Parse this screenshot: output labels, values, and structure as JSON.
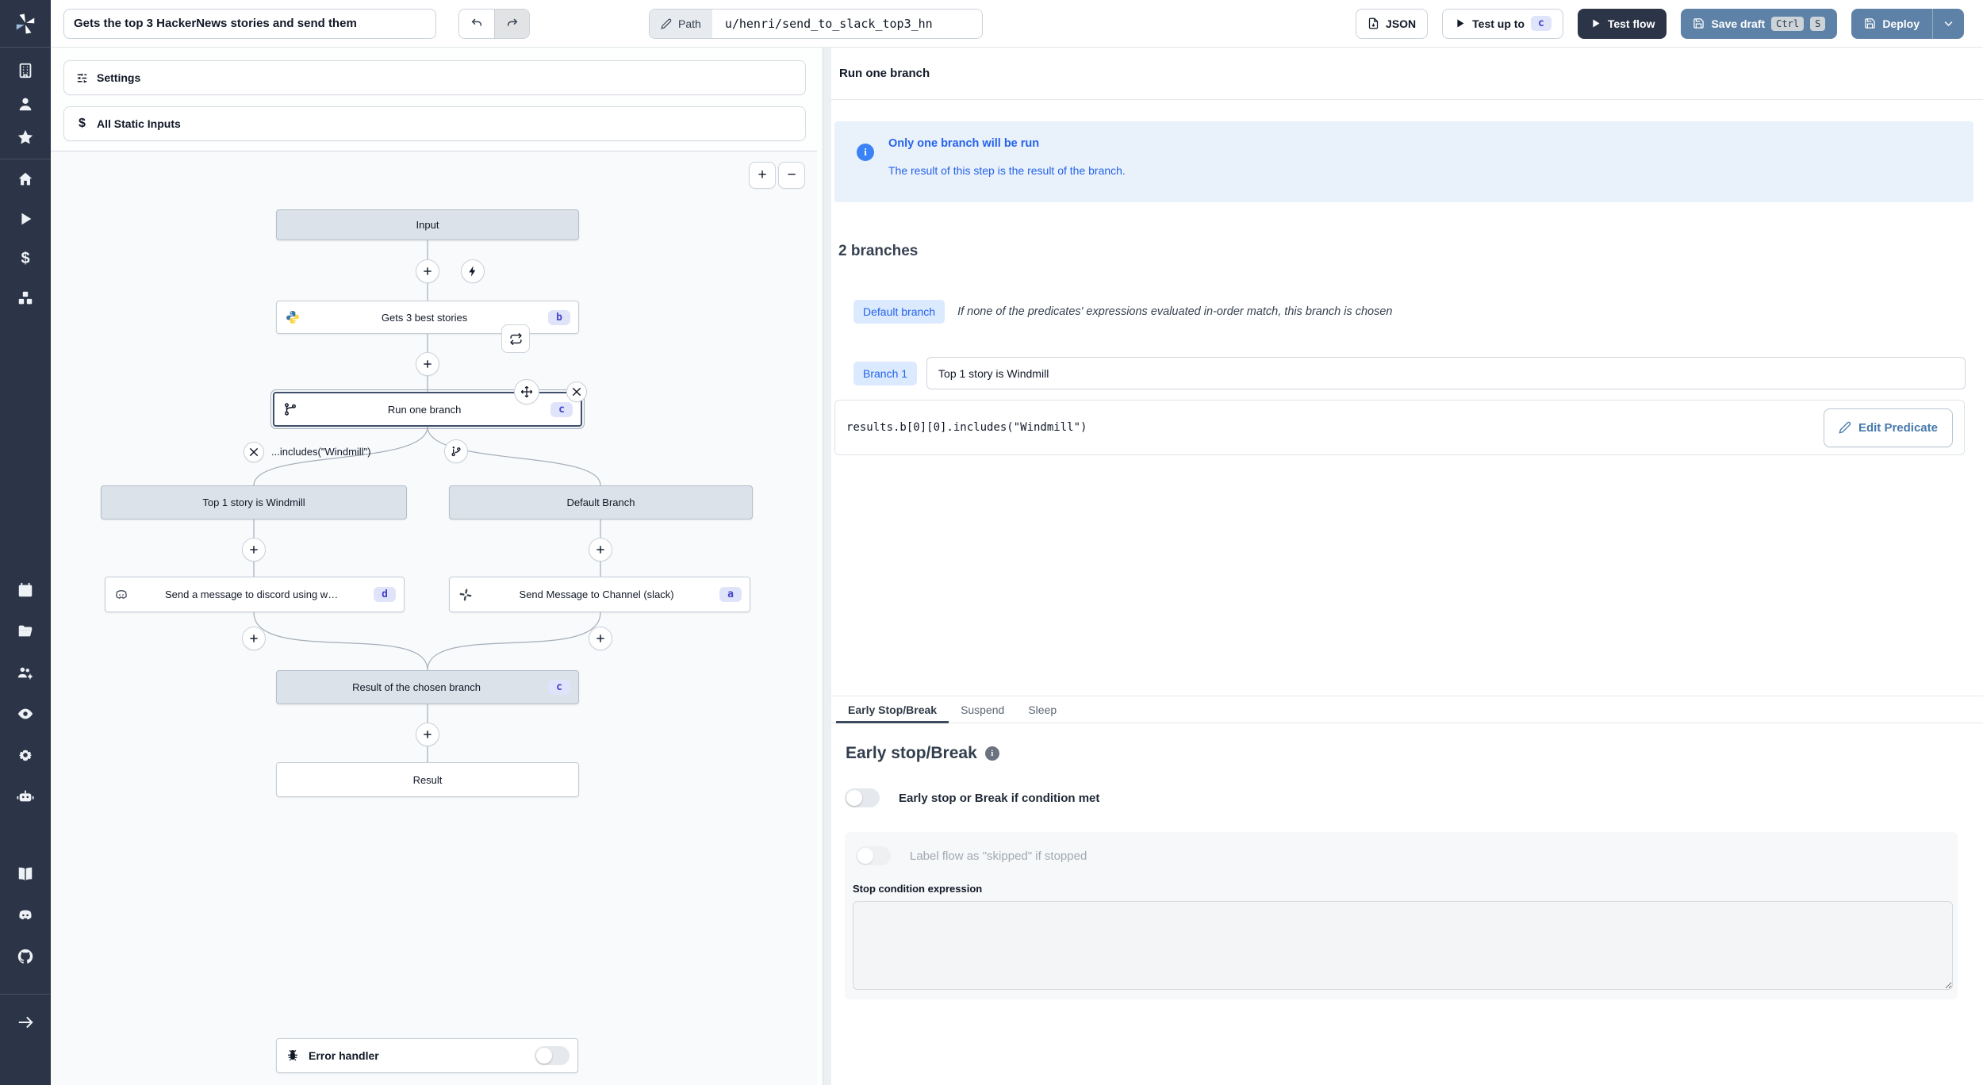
{
  "topbar": {
    "title_value": "Gets the top 3 HackerNews stories and send them",
    "path_label": "Path",
    "path_value": "u/henri/send_to_slack_top3_hn",
    "json_label": "JSON",
    "test_up_to_label": "Test up to",
    "test_up_to_badge": "c",
    "test_flow_label": "Test flow",
    "save_draft_label": "Save draft",
    "kbd_ctrl": "Ctrl",
    "kbd_s": "S",
    "deploy_label": "Deploy"
  },
  "sidebar": {
    "items": [
      "workspace",
      "user",
      "favorites",
      "home",
      "runs",
      "variables",
      "resources",
      "schedules",
      "folders",
      "groups",
      "audit-logs",
      "settings",
      "ai",
      "docs",
      "discord",
      "github",
      "expand"
    ]
  },
  "left_panel": {
    "settings_label": "Settings",
    "static_inputs_label": "All Static Inputs"
  },
  "flow": {
    "zoom_in": "+",
    "zoom_out": "−",
    "nodes": {
      "input": {
        "label": "Input"
      },
      "get_stories": {
        "label": "Gets 3 best stories",
        "badge": "b",
        "icon": "python-icon"
      },
      "run_one_branch": {
        "label": "Run one branch",
        "badge": "c",
        "icon": "git-branch-icon"
      },
      "predicate_label": "...includes(\"Windmill\")",
      "branch_left": {
        "label": "Top 1 story is Windmill"
      },
      "branch_right": {
        "label": "Default Branch"
      },
      "discord": {
        "label": "Send a message to discord using w…",
        "badge": "d",
        "icon": "discord-icon"
      },
      "slack": {
        "label": "Send Message to Channel (slack)",
        "badge": "a",
        "icon": "slack-icon"
      },
      "result_branch": {
        "label": "Result of the chosen branch",
        "badge": "c"
      },
      "result": {
        "label": "Result"
      },
      "error_handler": {
        "label": "Error handler",
        "icon": "bug-icon"
      }
    }
  },
  "inspector": {
    "title": "Run one branch",
    "info_title": "Only one branch will be run",
    "info_body": "The result of this step is the result of the branch.",
    "branches_heading": "2 branches",
    "default_branch_badge": "Default branch",
    "default_branch_desc": "If none of the predicates' expressions evaluated in-order match, this branch is chosen",
    "branch1_badge": "Branch 1",
    "branch1_value": "Top 1 story is Windmill",
    "predicate_code": "results.b[0][0].includes(\"Windmill\")",
    "edit_predicate_label": "Edit Predicate",
    "tabs": [
      "Early Stop/Break",
      "Suspend",
      "Sleep"
    ],
    "early_stop": {
      "heading": "Early stop/Break",
      "toggle_label": "Early stop or Break if condition met",
      "skipped_label": "Label flow as \"skipped\" if stopped",
      "stop_condition_label": "Stop condition expression"
    }
  },
  "colors": {
    "accent_blue": "#5e82a7",
    "dark": "#2b3547",
    "badge_indigo_bg": "#e0e4fb",
    "badge_indigo_text": "#4343c9",
    "info_blue": "#2563eb",
    "badge_blue_bg": "#dbeafe",
    "node_header_bg": "#dbe2e9",
    "canvas_bg": "#f8fafc"
  }
}
